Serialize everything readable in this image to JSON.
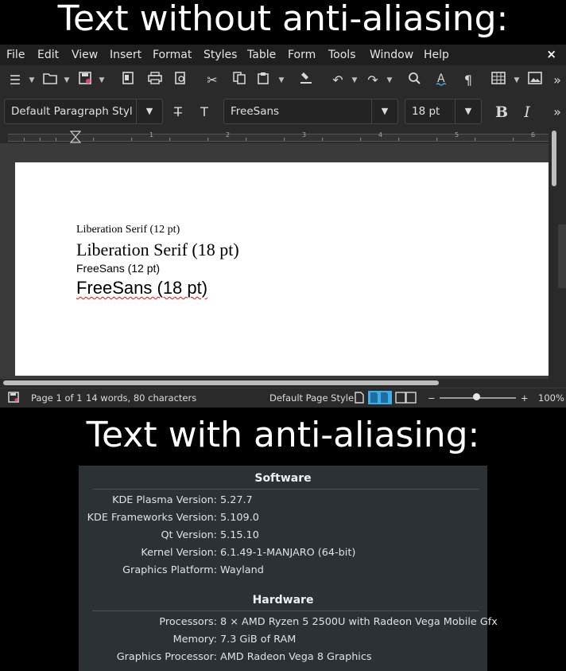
{
  "captions": {
    "top": "Text without anti-aliasing:",
    "bottom": "Text with anti-aliasing:"
  },
  "writer": {
    "menu": [
      "File",
      "Edit",
      "View",
      "Insert",
      "Format",
      "Styles",
      "Table",
      "Form",
      "Tools",
      "Window",
      "Help"
    ],
    "close_label": "×",
    "toolbar2": {
      "paragraph_style": "Default Paragraph Style",
      "font_name": "FreeSans",
      "font_size": "18 pt",
      "bold_label": "B",
      "italic_label": "I"
    },
    "ruler_numbers": [
      "1",
      "2",
      "3",
      "4",
      "5",
      "6"
    ],
    "document_lines": [
      "Liberation Serif (12 pt)",
      "Liberation Serif (18 pt)",
      "FreeSans (12 pt)",
      "FreeSans (18 pt)"
    ],
    "status": {
      "page": "Page 1 of 1",
      "counts": "14 words, 80 characters",
      "page_style": "Default Page Style",
      "zoom": "100%",
      "zoom_minus": "−",
      "zoom_plus": "+"
    },
    "colors": {
      "menubar": "#1f1f1f",
      "toolbar": "#2a2a2a",
      "accent": "#3daee9"
    }
  },
  "kde_info": {
    "software_title": "Software",
    "software": [
      {
        "label": "KDE Plasma Version:",
        "value": "5.27.7"
      },
      {
        "label": "KDE Frameworks Version:",
        "value": "5.109.0"
      },
      {
        "label": "Qt Version:",
        "value": "5.15.10"
      },
      {
        "label": "Kernel Version:",
        "value": "6.1.49-1-MANJARO (64-bit)"
      },
      {
        "label": "Graphics Platform:",
        "value": "Wayland"
      }
    ],
    "hardware_title": "Hardware",
    "hardware": [
      {
        "label": "Processors:",
        "value": "8 × AMD Ryzen 5 2500U with Radeon Vega Mobile Gfx"
      },
      {
        "label": "Memory:",
        "value": "7.3 GiB of RAM"
      },
      {
        "label": "Graphics Processor:",
        "value": "AMD Radeon Vega 8 Graphics"
      }
    ]
  }
}
